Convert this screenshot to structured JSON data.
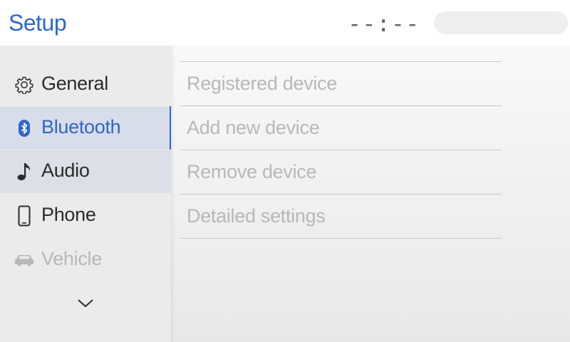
{
  "header": {
    "title": "Setup",
    "clock": "--:--"
  },
  "sidebar": {
    "items": [
      {
        "label": "General",
        "icon": "gear-icon",
        "state": "normal"
      },
      {
        "label": "Bluetooth",
        "icon": "bluetooth-icon",
        "state": "selected"
      },
      {
        "label": "Audio",
        "icon": "music-note-icon",
        "state": "highlighted"
      },
      {
        "label": "Phone",
        "icon": "phone-icon",
        "state": "normal"
      },
      {
        "label": "Vehicle",
        "icon": "car-icon",
        "state": "disabled"
      }
    ],
    "more_icon": "chevron-down-icon"
  },
  "bluetooth_menu": {
    "items": [
      {
        "label": "Registered device",
        "enabled": false
      },
      {
        "label": "Add new device",
        "enabled": false
      },
      {
        "label": "Remove device",
        "enabled": false
      },
      {
        "label": "Detailed settings",
        "enabled": false
      }
    ]
  },
  "colors": {
    "accent": "#2f66c9",
    "sidebar_bg": "#ebebeb",
    "selected_bg": "#d7dde9",
    "disabled_text": "#b8b8b8"
  }
}
